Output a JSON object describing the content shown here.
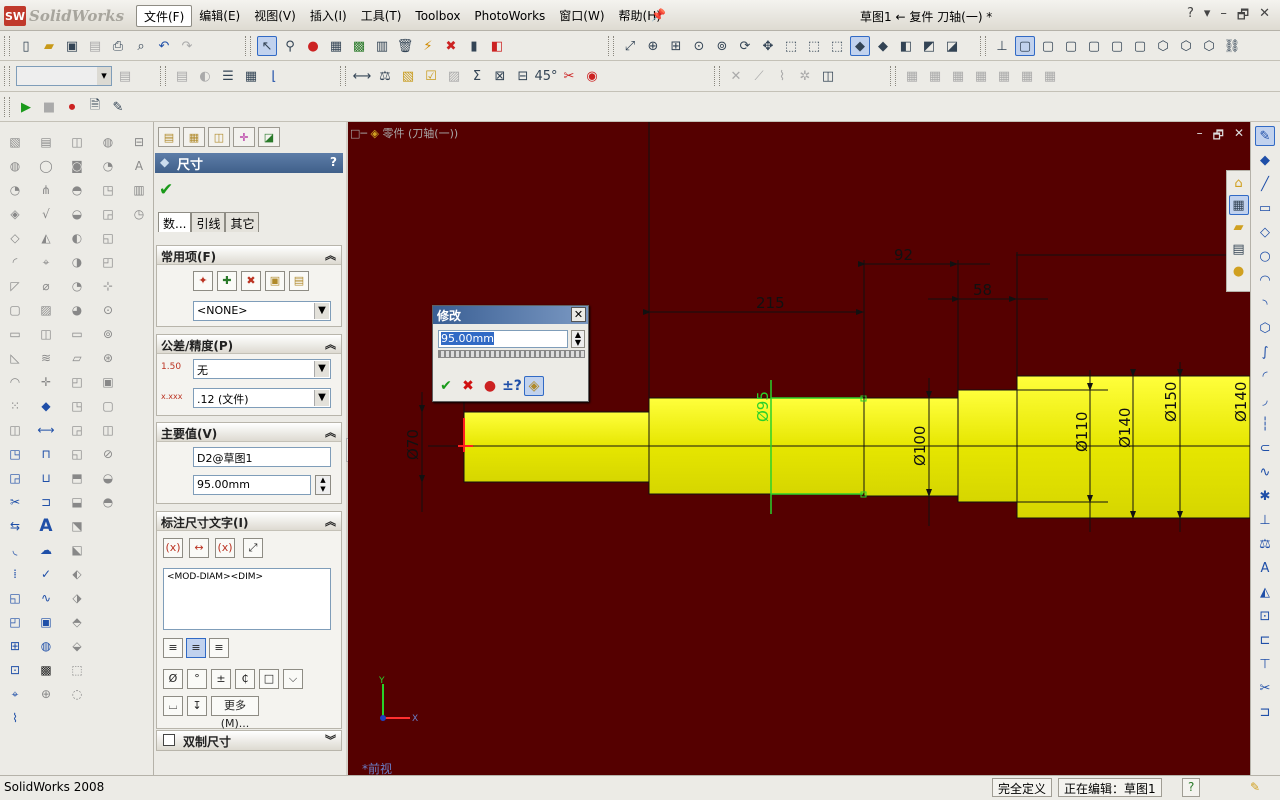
{
  "app": {
    "logo_text": "SolidWorks",
    "logo_badge": "SW",
    "document_title": "草图1 ← 复件 刀轴(一) *",
    "window_controls": [
      "?",
      "▾",
      "–",
      "🗗",
      "✕"
    ]
  },
  "menu": {
    "items": [
      "文件(F)",
      "编辑(E)",
      "视图(V)",
      "插入(I)",
      "工具(T)",
      "Toolbox",
      "PhotoWorks",
      "窗口(W)",
      "帮助(H)"
    ],
    "active_index": 0
  },
  "toolbar": {
    "style_select": "",
    "row2_label_angle": "45°"
  },
  "property_manager": {
    "title": "尺寸",
    "help": "?",
    "tabs": [
      "数...",
      "引线",
      "其它"
    ],
    "sections": {
      "favorites": {
        "title": "常用项(F)",
        "select": "<NONE>"
      },
      "tolerance": {
        "title": "公差/精度(P)",
        "tol_type": "无",
        "precision": ".12 (文件)",
        "tol_icon": "1.50",
        "prec_icon": "x.xxx"
      },
      "primary": {
        "title": "主要值(V)",
        "name": "D2@草图1",
        "value": "95.00mm"
      },
      "dim_text": {
        "title": "标注尺寸文字(I)",
        "text": "<MOD-DIAM><DIM>",
        "more": "更多(M)..."
      },
      "dual": {
        "title": "双制尺寸"
      }
    },
    "symbol_buttons": [
      "Ø",
      "°",
      "±",
      "₵",
      "□",
      "⌵"
    ],
    "symbol_row2": [
      "⌴",
      "↧"
    ]
  },
  "viewport": {
    "title": "零件 (刀轴(一))",
    "view_name": "*前视",
    "bg_color": "#550000",
    "shaft_color": "#f2f200",
    "axis_x": "X",
    "axis_y": "Y",
    "dimensions": [
      {
        "label": "215",
        "kind": "linear"
      },
      {
        "label": "92",
        "kind": "linear"
      },
      {
        "label": "58",
        "kind": "linear"
      },
      {
        "label": "Ø95",
        "kind": "diameter"
      },
      {
        "label": "Ø70",
        "kind": "diameter"
      },
      {
        "label": "Ø100",
        "kind": "diameter"
      },
      {
        "label": "Ø110",
        "kind": "diameter"
      },
      {
        "label": "Ø140",
        "kind": "diameter"
      },
      {
        "label": "Ø150",
        "kind": "diameter"
      },
      {
        "label": "Ø140",
        "kind": "diameter"
      }
    ]
  },
  "modify_dialog": {
    "title": "修改",
    "close": "✕",
    "value": "95.00mm"
  },
  "status_bar": {
    "app": "SolidWorks 2008",
    "state": "完全定义",
    "editing": "正在编辑：草图1",
    "help": "?"
  }
}
